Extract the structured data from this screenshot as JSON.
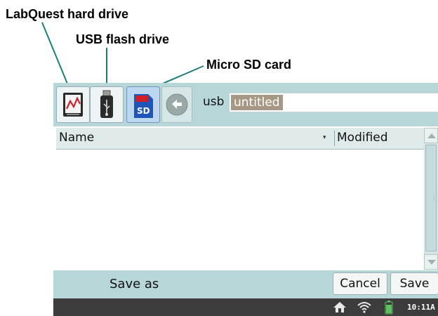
{
  "callouts": {
    "labquest": "LabQuest hard drive",
    "usb": "USB flash drive",
    "sd": "Micro SD card"
  },
  "toolbar": {
    "buttons": [
      {
        "icon": "labquest-drive-icon"
      },
      {
        "icon": "usb-drive-icon"
      },
      {
        "icon": "sd-card-icon",
        "label": "SD",
        "selected": true
      },
      {
        "icon": "back-arrow-icon"
      }
    ],
    "path": "usb",
    "filename_value": "untitled"
  },
  "file_list": {
    "columns": [
      "Name",
      "Modified"
    ],
    "sort_indicator": "▾",
    "rows": []
  },
  "footer": {
    "prompt": "Save as",
    "cancel_label": "Cancel",
    "save_label": "Save"
  },
  "status": {
    "clock": "10:11A",
    "icons": [
      "home-icon",
      "wifi-icon",
      "battery-icon"
    ]
  },
  "colors": {
    "toolbar_bg": "#b6d6d8",
    "selection_bg": "#a69885",
    "status_bg": "#3c3c3c",
    "sd_blue": "#1d56b8",
    "sd_red": "#d11f2a"
  }
}
